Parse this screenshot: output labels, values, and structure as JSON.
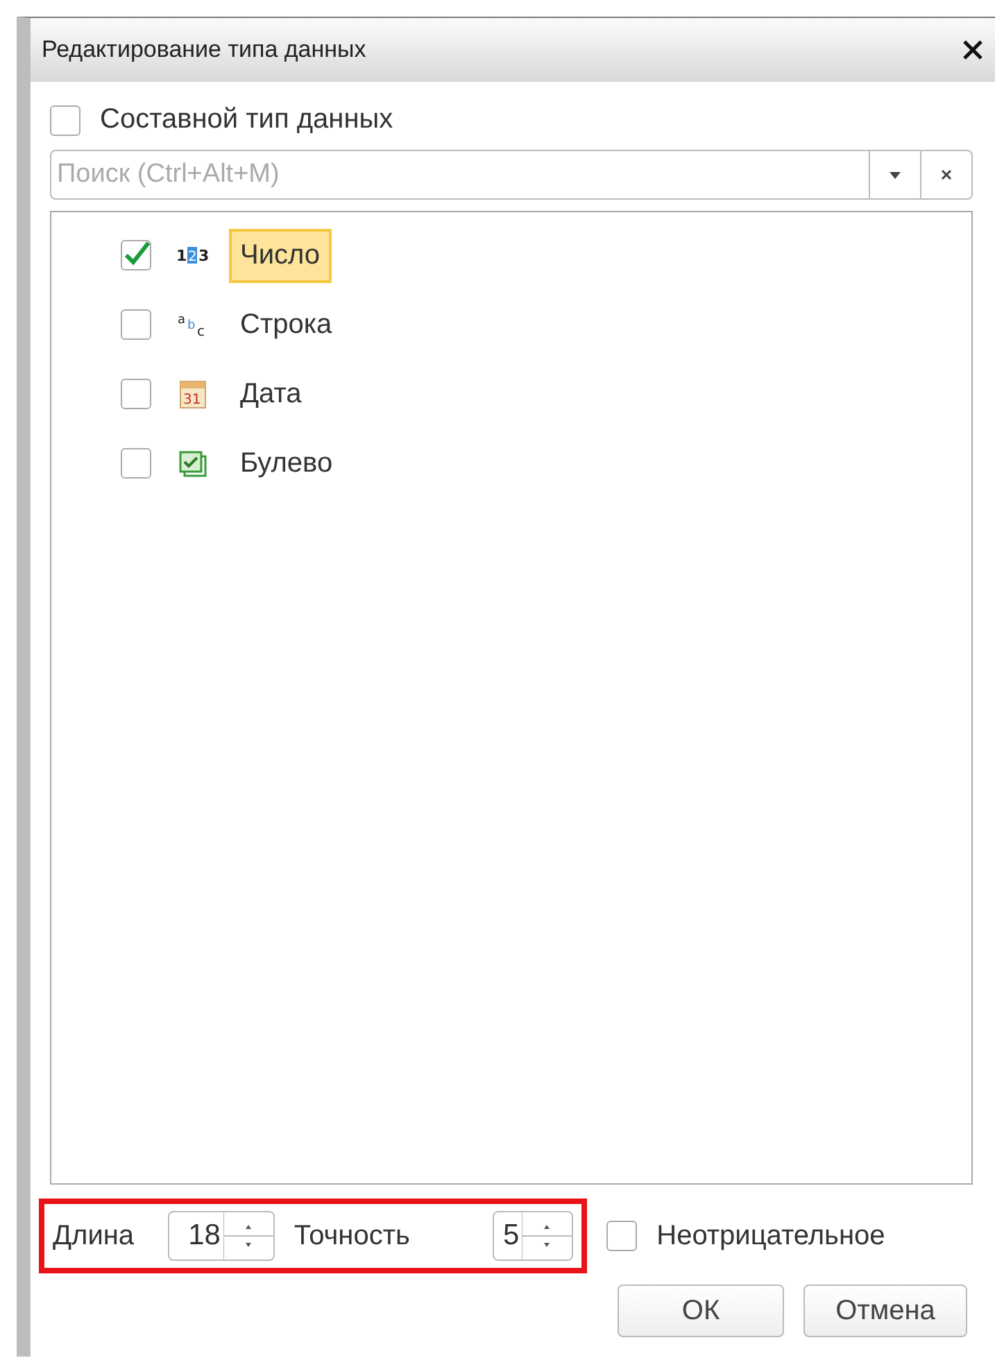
{
  "window": {
    "title": "Редактирование типа данных"
  },
  "composite": {
    "label": "Составной тип данных",
    "checked": false
  },
  "search": {
    "placeholder": "Поиск (Ctrl+Alt+M)"
  },
  "types": [
    {
      "label": "Число",
      "kind": "number",
      "icon_text": [
        "1",
        "2",
        "3"
      ],
      "checked": true,
      "selected": true
    },
    {
      "label": "Строка",
      "kind": "string",
      "icon_text": [
        "a",
        "b",
        "c"
      ],
      "checked": false,
      "selected": false
    },
    {
      "label": "Дата",
      "kind": "date",
      "icon_text": [
        "31"
      ],
      "checked": false,
      "selected": false
    },
    {
      "label": "Булево",
      "kind": "boolean",
      "checked": false,
      "selected": false
    }
  ],
  "length": {
    "label": "Длина",
    "value": "18"
  },
  "precision": {
    "label": "Точность",
    "value": "5"
  },
  "nonnegative": {
    "label": "Неотрицательное",
    "checked": false
  },
  "buttons": [
    "ОК",
    "Отмена"
  ]
}
